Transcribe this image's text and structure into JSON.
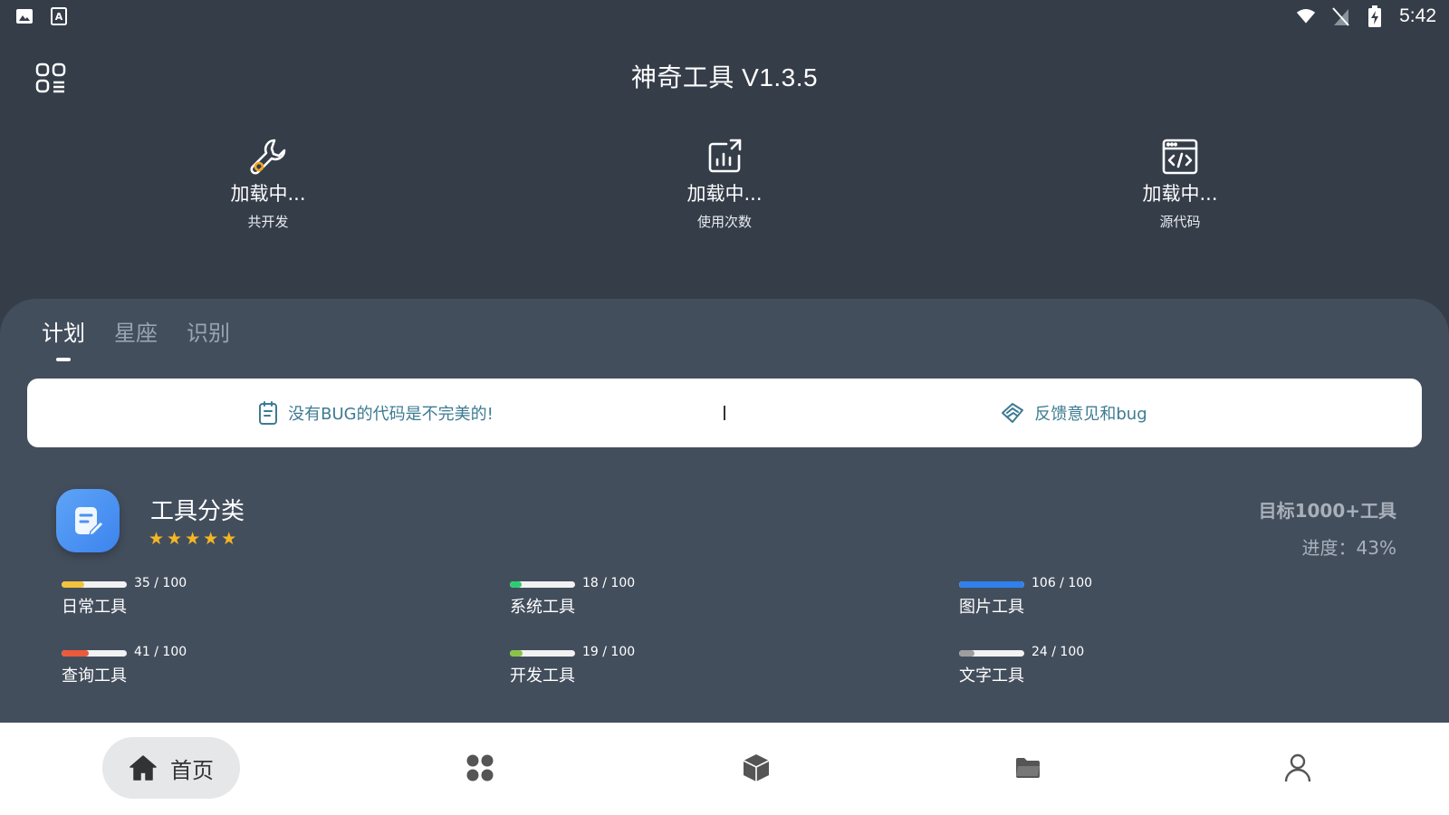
{
  "status_bar": {
    "time": "5:42",
    "left_icons": [
      "image-icon",
      "a-keyboard-icon"
    ],
    "right_icons": [
      "wifi-icon",
      "no-sim-icon",
      "battery-charging-icon"
    ]
  },
  "app": {
    "title": "神奇工具 V1.3.5"
  },
  "stats": [
    {
      "value": "加载中...",
      "label": "共开发",
      "icon": "wrench-icon"
    },
    {
      "value": "加载中...",
      "label": "使用次数",
      "icon": "chart-share-icon"
    },
    {
      "value": "加载中...",
      "label": "源代码",
      "icon": "code-window-icon"
    }
  ],
  "tabs": [
    {
      "label": "计划",
      "active": true
    },
    {
      "label": "星座",
      "active": false
    },
    {
      "label": "识别",
      "active": false
    }
  ],
  "notice": {
    "left_text": "没有BUG的代码是不完美的!",
    "right_text": "反馈意见和bug"
  },
  "category": {
    "title": "工具分类",
    "stars": 5,
    "goal_title": "目标1000+工具",
    "goal_progress": "进度：43%"
  },
  "tools": [
    {
      "name": "日常工具",
      "count": "35 / 100",
      "progress": 0.35,
      "color": "#f5c33b"
    },
    {
      "name": "系统工具",
      "count": "18 / 100",
      "progress": 0.18,
      "color": "#2ecc71"
    },
    {
      "name": "图片工具",
      "count": "106 / 100",
      "progress": 1.0,
      "color": "#2f80ed"
    },
    {
      "name": "查询工具",
      "count": "41 / 100",
      "progress": 0.41,
      "color": "#eb5a3c"
    },
    {
      "name": "开发工具",
      "count": "19 / 100",
      "progress": 0.19,
      "color": "#8bc34a"
    },
    {
      "name": "文字工具",
      "count": "24 / 100",
      "progress": 0.24,
      "color": "#9e9e9e"
    }
  ],
  "bottom_nav": {
    "home_label": "首页",
    "items": [
      "home-icon",
      "apps-icon",
      "cube-icon",
      "folder-icon",
      "person-icon"
    ]
  },
  "colors": {
    "background": "#353d49",
    "panel": "#434e5d",
    "notice_text": "#3d7b92",
    "star": "#f5b623"
  }
}
